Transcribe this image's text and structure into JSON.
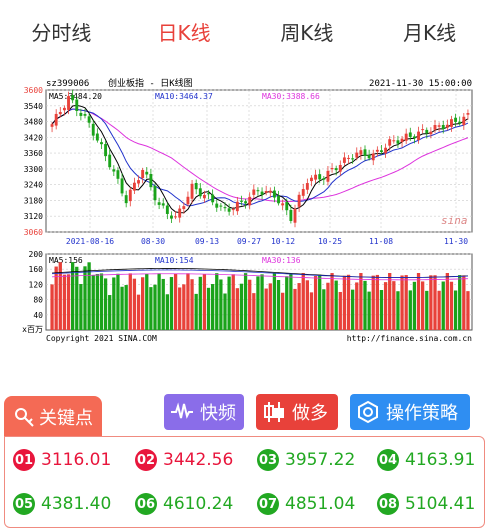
{
  "tabs": [
    {
      "label": "分时线",
      "active": false
    },
    {
      "label": "日K线",
      "active": true
    },
    {
      "label": "周K线",
      "active": false
    },
    {
      "label": "月K线",
      "active": false
    }
  ],
  "chart": {
    "code": "sz399006",
    "name": "创业板指 - 日K线图",
    "datetime": "2021-11-30 15:00:00",
    "copyright": "Copyright 2021 SINA.COM",
    "source": "http://finance.sina.com.cn",
    "watermark": "sina",
    "price_ma": {
      "ma5": "MA5:3484.20",
      "ma10": "MA10:3464.37",
      "ma30": "MA30:3388.66"
    },
    "vol_ma": {
      "ma5": "MA5:156",
      "ma10": "MA10:154",
      "ma30": "MA30:136"
    },
    "vol_unit": "x百万",
    "colors": {
      "up": "#e8413a",
      "down": "#1aa31a",
      "ma5": "#000000",
      "ma10": "#2233cc",
      "ma30": "#dd33dd"
    }
  },
  "chart_data": {
    "type": "candlestick",
    "title": "创业板指 - 日K线图",
    "price_axis": {
      "ticks": [
        3600,
        3540,
        3480,
        3420,
        3360,
        3300,
        3240,
        3180,
        3120,
        3060
      ],
      "ylim": [
        3060,
        3600
      ]
    },
    "volume_axis": {
      "ticks": [
        200,
        160,
        120,
        80,
        40
      ],
      "ylim": [
        0,
        200
      ]
    },
    "x_ticks": [
      "2021-08-16",
      "08-30",
      "09-13",
      "09-27",
      "10-12",
      "10-25",
      "11-08",
      "11-30"
    ],
    "grid": true
  },
  "buttons": {
    "key_points": "关键点",
    "kuaipin": "快频",
    "zuoduo": "做多",
    "strategy": "操作策略"
  },
  "key_points": [
    {
      "num": "01",
      "value": "3116.01",
      "color": "#e8163c"
    },
    {
      "num": "02",
      "value": "3442.56",
      "color": "#e8163c"
    },
    {
      "num": "03",
      "value": "3957.22",
      "color": "#22a822"
    },
    {
      "num": "04",
      "value": "4163.91",
      "color": "#22a822"
    },
    {
      "num": "05",
      "value": "4381.40",
      "color": "#22a822"
    },
    {
      "num": "06",
      "value": "4610.24",
      "color": "#22a822"
    },
    {
      "num": "07",
      "value": "4851.04",
      "color": "#22a822"
    },
    {
      "num": "08",
      "value": "5104.41",
      "color": "#22a822"
    }
  ]
}
